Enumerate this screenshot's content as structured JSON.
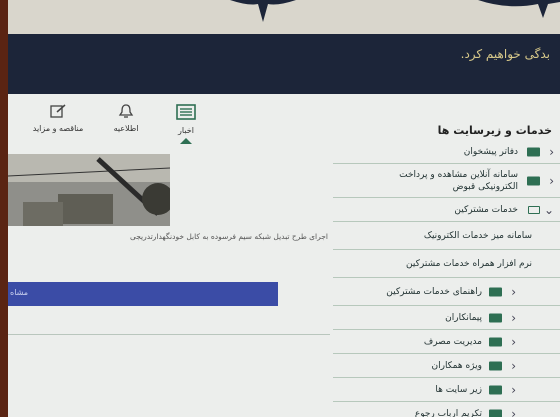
{
  "banner": {
    "text": "بدگی خواهیم کرد."
  },
  "tabs": [
    {
      "label": "اخبار",
      "icon": "news-icon",
      "active": true
    },
    {
      "label": "اطلاعیه",
      "icon": "bell-icon",
      "active": false
    },
    {
      "label": "مناقصه و مزاید",
      "icon": "edit-icon",
      "active": false
    }
  ],
  "news": {
    "caption": "اجرای طرح تبدیل شبکه سیم فرسوده به کابل خودنگهدارتدریجی"
  },
  "blue_bar": {
    "text": "مشاه"
  },
  "services": {
    "title": "خدمات و زیرسایت ها",
    "items": [
      {
        "label": "دفاتر پیشخوان"
      },
      {
        "label": "سامانه آنلاین مشاهده و پرداخت الکترونیکی قبوض"
      },
      {
        "label": "خدمات مشترکین"
      },
      {
        "label": "سامانه میز خدمات الکترونیک"
      },
      {
        "label": "نرم افزار همراه خدمات مشترکین"
      },
      {
        "label": "راهنمای خدمات مشترکین"
      },
      {
        "label": "پیمانکاران"
      },
      {
        "label": "مدیریت مصرف"
      },
      {
        "label": "ویژه همکاران"
      },
      {
        "label": "زیر سایت ها"
      },
      {
        "label": "تکریم ارباب رجوع"
      }
    ]
  },
  "colors": {
    "banner_bg": "#1c2539",
    "banner_text": "#d8c98a",
    "folder": "#2e6f53",
    "blue_bar": "#3b4ca6"
  }
}
